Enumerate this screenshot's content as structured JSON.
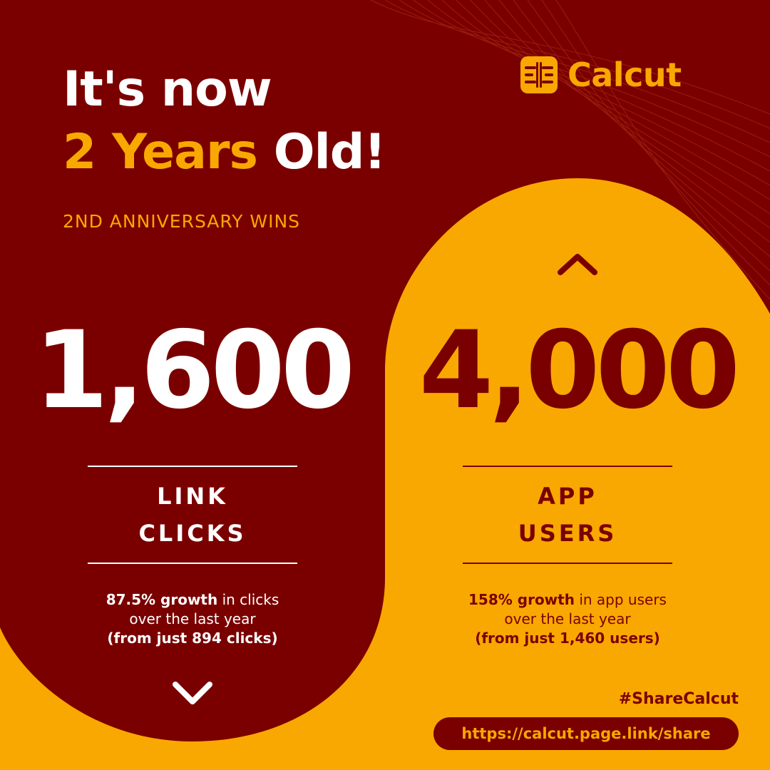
{
  "colors": {
    "maroon": "#7A0000",
    "gold": "#F8A800",
    "white": "#FFFFFF"
  },
  "headline": {
    "line1": "It's now",
    "line2_highlight": "2 Years",
    "line2_rest": " Old!"
  },
  "subtitle": "2ND ANNIVERSARY WINS",
  "brand": {
    "name": "Calcut",
    "logo_icon": "calcut-logo-icon"
  },
  "left_stat": {
    "value": "1,600",
    "label_line1": "LINK",
    "label_line2": "CLICKS",
    "desc_bold1": "87.5% growth",
    "desc_rest1": " in clicks",
    "desc_line2": "over the last year",
    "desc_bold3": "(from just 894 clicks)",
    "icon": "chevron-down-icon"
  },
  "right_stat": {
    "value": "4,000",
    "label_line1": "APP",
    "label_line2": "USERS",
    "desc_bold1": "158% growth",
    "desc_rest1": " in app users",
    "desc_line2": "over the last year",
    "desc_bold3": "(from just 1,460 users)",
    "icon": "chevron-up-icon"
  },
  "footer": {
    "hashtag": "#ShareCalcut",
    "url": "https://calcut.page.link/share"
  }
}
